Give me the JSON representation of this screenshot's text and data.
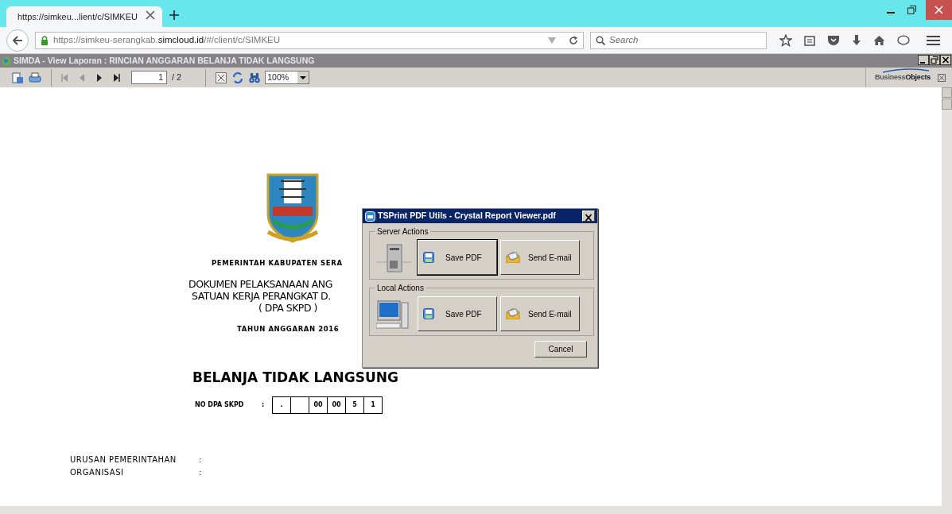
{
  "browser": {
    "tab": {
      "title": "https://simkeu...lient/c/SIMKEU",
      "selected": true
    },
    "url": {
      "prefix": "https://simkeu-serangkab.",
      "domain": "simcloud.id",
      "suffix": "/#/client/c/SIMKEU"
    },
    "search": {
      "placeholder": "Search"
    }
  },
  "app": {
    "title": "SIMDA - View Laporan : RINCIAN ANGGARAN BELANJA TIDAK LANGSUNG",
    "toolbar": {
      "page": "1",
      "page_total": "/ 2",
      "zoom": "100%"
    },
    "brand": {
      "part_1": "Business",
      "part_2": "Objects"
    }
  },
  "report": {
    "header": [
      "PEMERINTAH KABUPATEN SERA",
      "DOKUMEN PELAKSANAAN ANG",
      "SATUAN KERJA PERANGKAT D.",
      "( DPA SKPD )",
      "TAHUN ANGGARAN 2016"
    ],
    "section_title": "BELANJA TIDAK LANGSUNG",
    "dpa": {
      "label": "NO DPA SKPD",
      "colon": ":",
      "cells": [
        ".",
        null,
        "00",
        "00",
        "5",
        "1"
      ]
    },
    "fields": [
      {
        "label": "URUSAN PEMERINTAHAN",
        "colon": ":"
      },
      {
        "label": "ORGANISASI",
        "colon": ":"
      }
    ]
  },
  "dialog": {
    "title": "TSPrint PDF Utils - Crystal Report Viewer.pdf",
    "groups": [
      {
        "label": "Server Actions",
        "kind": "server",
        "buttons": [
          {
            "label": "Save PDF",
            "kind": "save",
            "focused": true
          },
          {
            "label": "Send E-mail",
            "kind": "email",
            "focused": false
          }
        ]
      },
      {
        "label": "Local Actions",
        "kind": "local",
        "buttons": [
          {
            "label": "Save PDF",
            "kind": "save",
            "focused": false
          },
          {
            "label": "Send E-mail",
            "kind": "email",
            "focused": false
          }
        ]
      }
    ],
    "cancel": "Cancel"
  }
}
